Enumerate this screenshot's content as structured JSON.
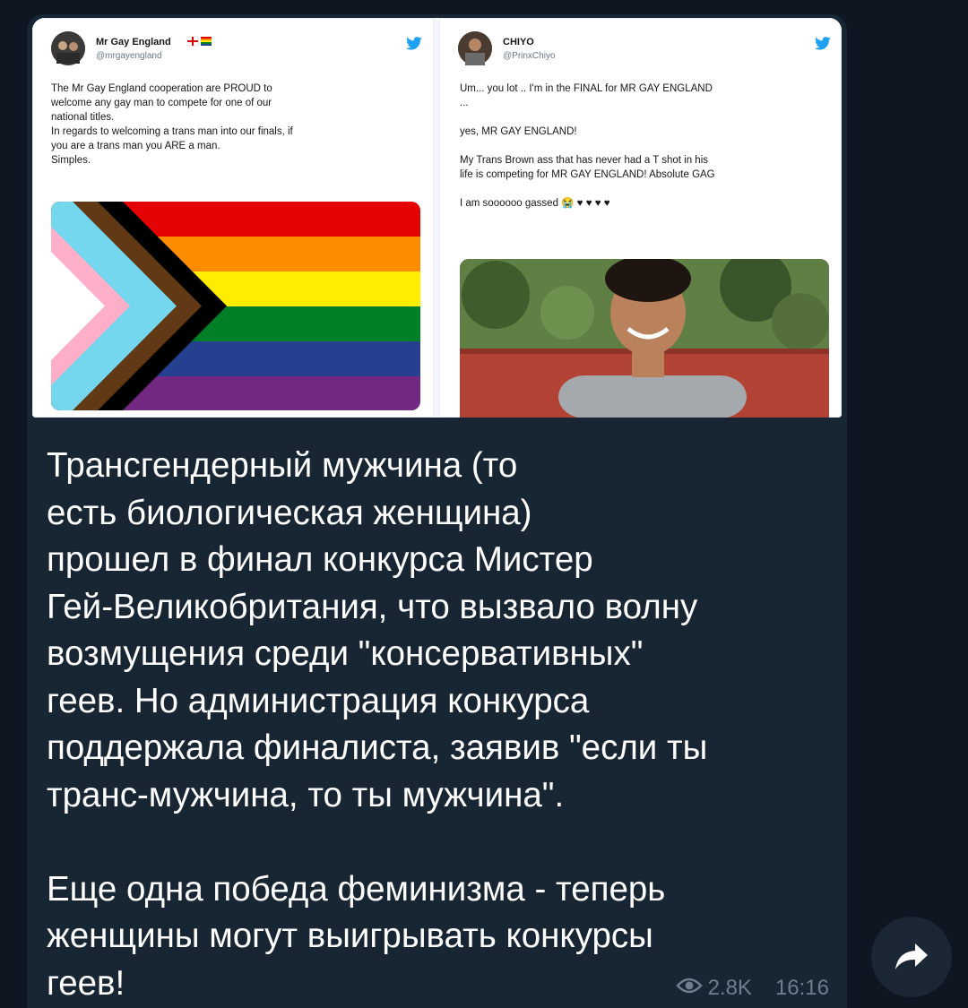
{
  "tweets": [
    {
      "name": "Mr Gay England",
      "handle": "@mrgayengland",
      "text": "The Mr Gay England cooperation are PROUD to\nwelcome any gay man to compete for one of our\nnational titles.\nIn regards to welcoming a trans man into our finals, if\nyou are a trans man you ARE a man.\nSimples."
    },
    {
      "name": "CHIYO",
      "handle": "@PrinxChiyo",
      "text": "Um... you lot .. I'm in the FINAL for MR GAY ENGLAND\n...\n\nyes, MR GAY ENGLAND!\n\nMy Trans Brown ass that has never had a T shot in his\nlife is competing for MR GAY ENGLAND! Absolute GAG\n\nI am soooooo gassed 😭 ♥ ♥ ♥ ♥"
    }
  ],
  "message": {
    "text": "Трансгендерный мужчина (то\nесть биологическая женщина)\nпрошел в финал конкурса Мистер\nГей-Великобритания, что вызвало волну\nвозмущения среди \"консервативных\"\nгеев. Но администрация конкурса\nподдержала финалиста, заявив \"если ты\nтранс-мужчина, то ты мужчина\".\n\nЕще одна победа феминизма - теперь\nженщины могут выигрывать конкурсы\nгеев!",
    "views": "2.8K",
    "time": "16:16"
  },
  "colors": {
    "background": "#0e1621",
    "bubble": "#182533",
    "meta": "#6d7f8f",
    "twitter_blue": "#1da1f2"
  },
  "icons": [
    "twitter-bird-icon",
    "eye-icon",
    "share-arrow-icon"
  ]
}
